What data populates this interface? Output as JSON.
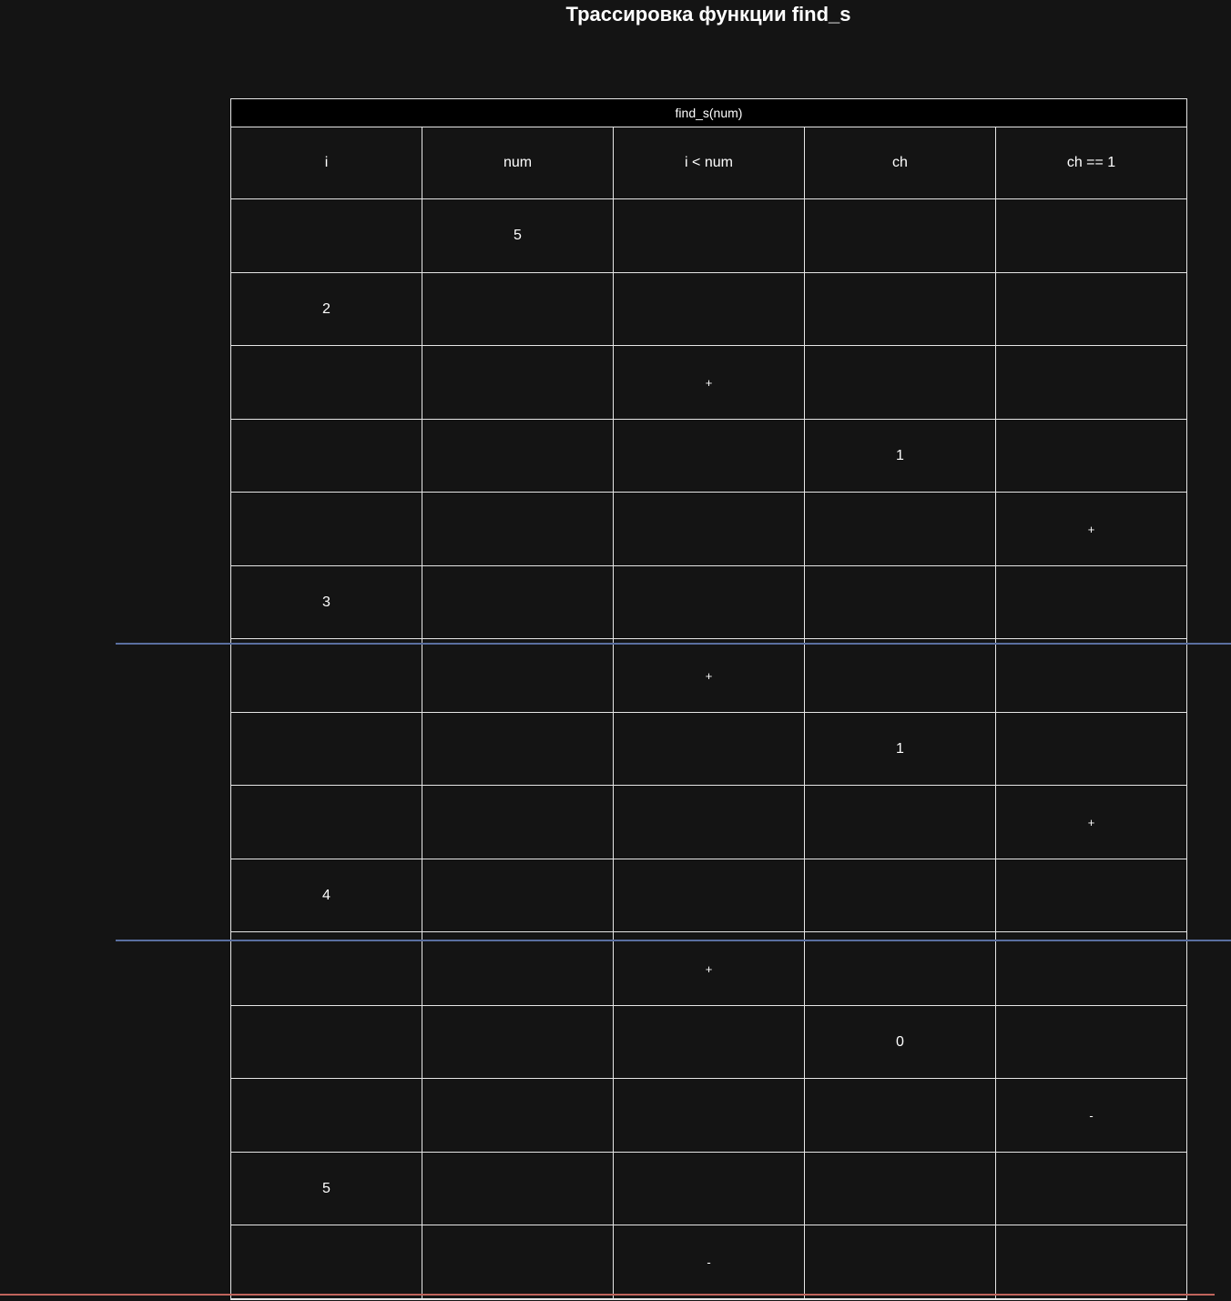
{
  "title": "Трассировка функции find_s",
  "table": {
    "caption": "find_s(num)",
    "columns": [
      "i",
      "num",
      "i < num",
      "ch",
      "ch == 1"
    ],
    "rows": [
      [
        "",
        "5",
        "",
        "",
        ""
      ],
      [
        "2",
        "",
        "",
        "",
        ""
      ],
      [
        "",
        "",
        "+",
        "",
        ""
      ],
      [
        "",
        "",
        "",
        "1",
        ""
      ],
      [
        "",
        "",
        "",
        "",
        "+"
      ],
      [
        "3",
        "",
        "",
        "",
        ""
      ],
      [
        "",
        "",
        "+",
        "",
        ""
      ],
      [
        "",
        "",
        "",
        "1",
        ""
      ],
      [
        "",
        "",
        "",
        "",
        "+"
      ],
      [
        "4",
        "",
        "",
        "",
        ""
      ],
      [
        "",
        "",
        "+",
        "",
        ""
      ],
      [
        "",
        "",
        "",
        "0",
        ""
      ],
      [
        "",
        "",
        "",
        "",
        "-"
      ],
      [
        "5",
        "",
        "",
        "",
        ""
      ],
      [
        "",
        "",
        "-",
        "",
        ""
      ]
    ]
  },
  "colors": {
    "background": "#141414",
    "grid": "#e6e6e6",
    "iteration_divider": "#5a6fa0",
    "end_divider": "#c0645c"
  }
}
